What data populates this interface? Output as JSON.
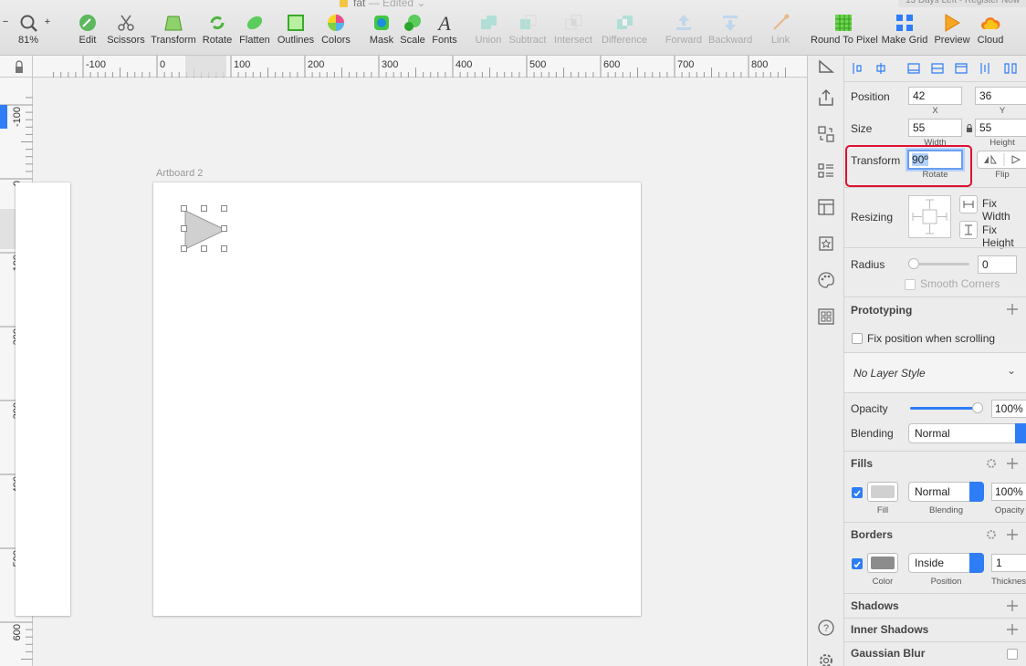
{
  "window": {
    "title": "fat",
    "edited": "— Edited",
    "trial": "13 Days Left - Register Now"
  },
  "toolbar": {
    "zoom": "81%",
    "tools": [
      {
        "label": "Edit",
        "icon": "edit-icon"
      },
      {
        "label": "Scissors",
        "icon": "scissors-icon"
      },
      {
        "label": "Transform",
        "icon": "transform-icon"
      },
      {
        "label": "Rotate",
        "icon": "rotate-icon"
      },
      {
        "label": "Flatten",
        "icon": "flatten-icon"
      },
      {
        "label": "Outlines",
        "icon": "outlines-icon"
      },
      {
        "label": "Colors",
        "icon": "colors-icon"
      },
      {
        "label": "Mask",
        "icon": "mask-icon"
      },
      {
        "label": "Scale",
        "icon": "scale-icon"
      },
      {
        "label": "Fonts",
        "icon": "fonts-icon"
      },
      {
        "label": "Union",
        "icon": "union-icon"
      },
      {
        "label": "Subtract",
        "icon": "subtract-icon"
      },
      {
        "label": "Intersect",
        "icon": "intersect-icon"
      },
      {
        "label": "Difference",
        "icon": "difference-icon"
      },
      {
        "label": "Forward",
        "icon": "forward-icon"
      },
      {
        "label": "Backward",
        "icon": "backward-icon"
      },
      {
        "label": "Link",
        "icon": "link-icon"
      },
      {
        "label": "Round To Pixel",
        "icon": "round-to-pixel-icon"
      },
      {
        "label": "Make Grid",
        "icon": "make-grid-icon"
      },
      {
        "label": "Preview",
        "icon": "preview-icon"
      },
      {
        "label": "Cloud",
        "icon": "cloud-icon"
      }
    ]
  },
  "rulers": {
    "h_labels": [
      "-100",
      "0",
      "100",
      "200",
      "300",
      "400",
      "500",
      "600",
      "700",
      "800"
    ],
    "v_labels": [
      "-100",
      "0",
      "100",
      "200",
      "300",
      "400",
      "500",
      "600"
    ]
  },
  "canvas": {
    "artboard_label": "Artboard 2"
  },
  "inspector": {
    "position": {
      "label": "Position",
      "x": "42",
      "y": "36",
      "x_sub": "X",
      "y_sub": "Y"
    },
    "size": {
      "label": "Size",
      "width": "55",
      "height": "55",
      "width_sub": "Width",
      "height_sub": "Height"
    },
    "transform": {
      "label": "Transform",
      "rotate": "90º",
      "rotate_sub": "Rotate",
      "flip_sub": "Flip"
    },
    "resizing": {
      "label": "Resizing",
      "fix_width": "Fix Width",
      "fix_height": "Fix Height"
    },
    "radius": {
      "label": "Radius",
      "value": "0",
      "smooth": "Smooth Corners"
    },
    "prototyping": {
      "label": "Prototyping",
      "fix_position": "Fix position when scrolling"
    },
    "layer_style": "No Layer Style",
    "opacity": {
      "label": "Opacity",
      "value": "100%",
      "level": 1.0
    },
    "blending": {
      "label": "Blending",
      "value": "Normal"
    },
    "fills": {
      "label": "Fills",
      "blend": "Normal",
      "opacity": "100%",
      "sub_fill": "Fill",
      "sub_blending": "Blending",
      "sub_opacity": "Opacity",
      "color": "#d0d0d0"
    },
    "borders": {
      "label": "Borders",
      "position": "Inside",
      "thickness": "1",
      "sub_color": "Color",
      "sub_position": "Position",
      "sub_thickness": "Thickness",
      "color": "#8c8c8c"
    },
    "shadows": "Shadows",
    "inner_shadows": "Inner Shadows",
    "gaussian_blur": "Gaussian Blur"
  }
}
